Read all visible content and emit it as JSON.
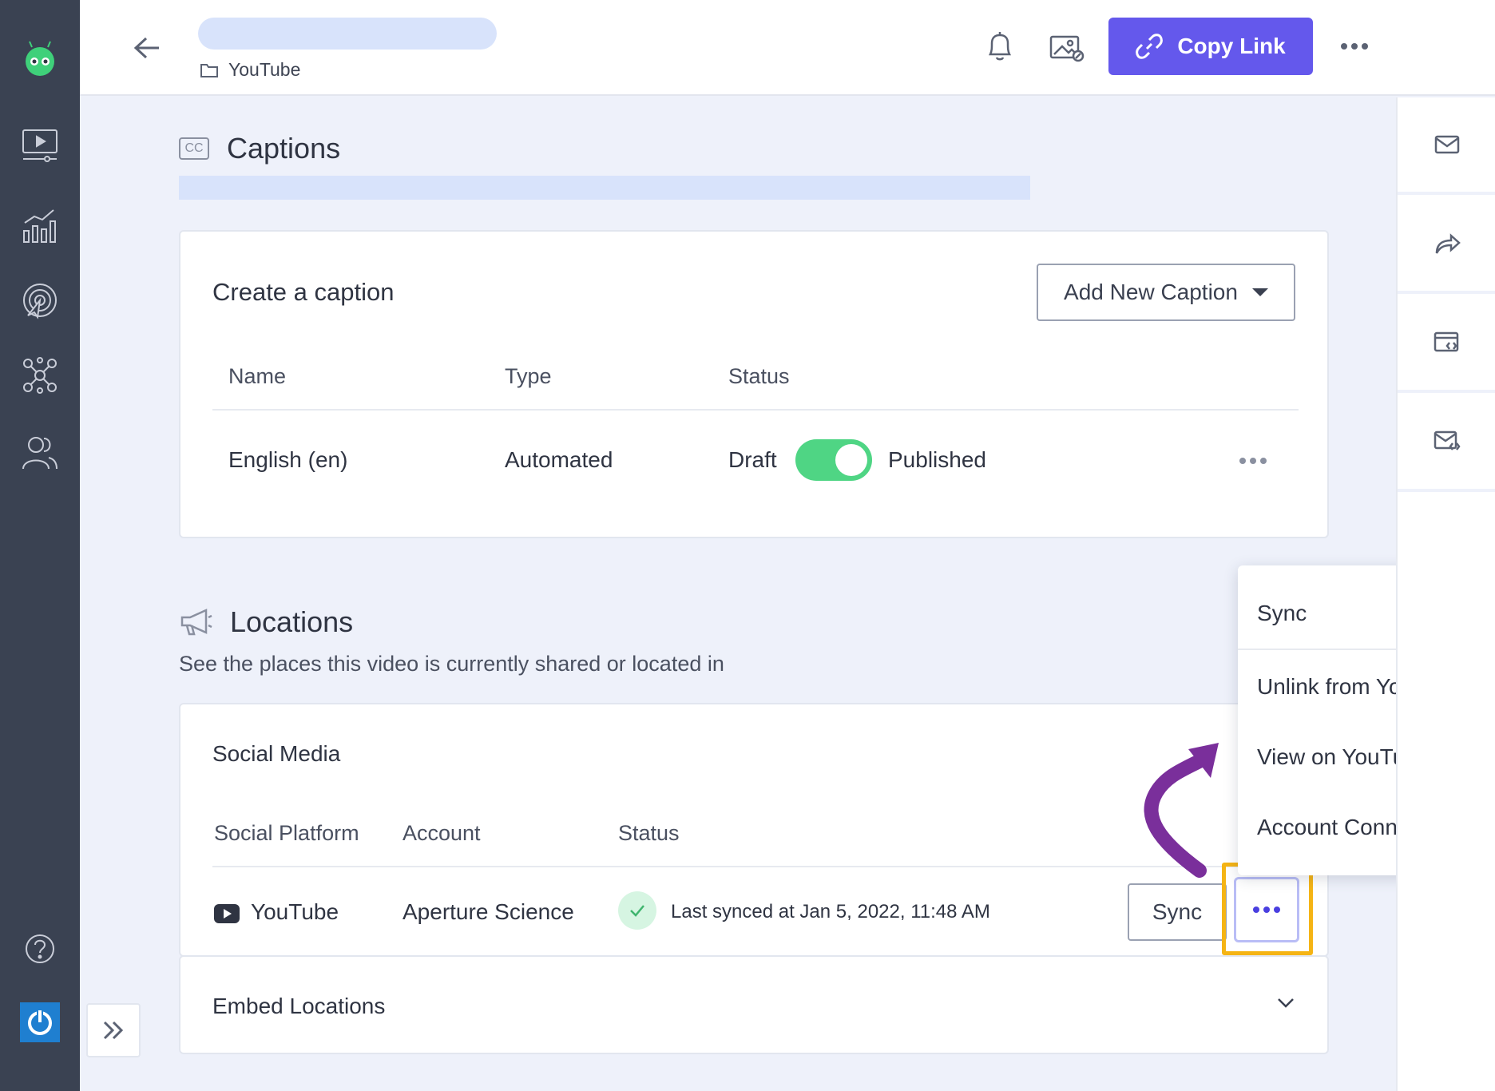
{
  "header": {
    "breadcrumb_folder": "YouTube",
    "copy_link_label": "Copy Link"
  },
  "captions": {
    "heading": "Captions",
    "cc_badge": "CC",
    "card_title": "Create a caption",
    "add_button_label": "Add New Caption",
    "columns": [
      "Name",
      "Type",
      "Status"
    ],
    "rows": [
      {
        "name": "English (en)",
        "type": "Automated",
        "status_off": "Draft",
        "status_on": "Published",
        "published": true
      }
    ]
  },
  "locations": {
    "heading": "Locations",
    "subtitle": "See the places this video is currently shared or located in",
    "social_title": "Social Media",
    "columns": [
      "Social Platform",
      "Account",
      "Status"
    ],
    "row": {
      "platform": "YouTube",
      "account": "Aperture Science",
      "status": "Last synced at Jan 5, 2022, 11:48 AM",
      "sync_label": "Sync"
    },
    "embed_title": "Embed Locations"
  },
  "dropdown_menu": {
    "items": [
      "Sync",
      "Unlink from YouTube",
      "View on YouTube",
      "Account Connection"
    ]
  },
  "colors": {
    "accent": "#6458ec",
    "nav_bg": "#3a4252",
    "toggle_on": "#4fd584",
    "highlight": "#f5b414",
    "annotation_arrow": "#7a2f9b"
  }
}
